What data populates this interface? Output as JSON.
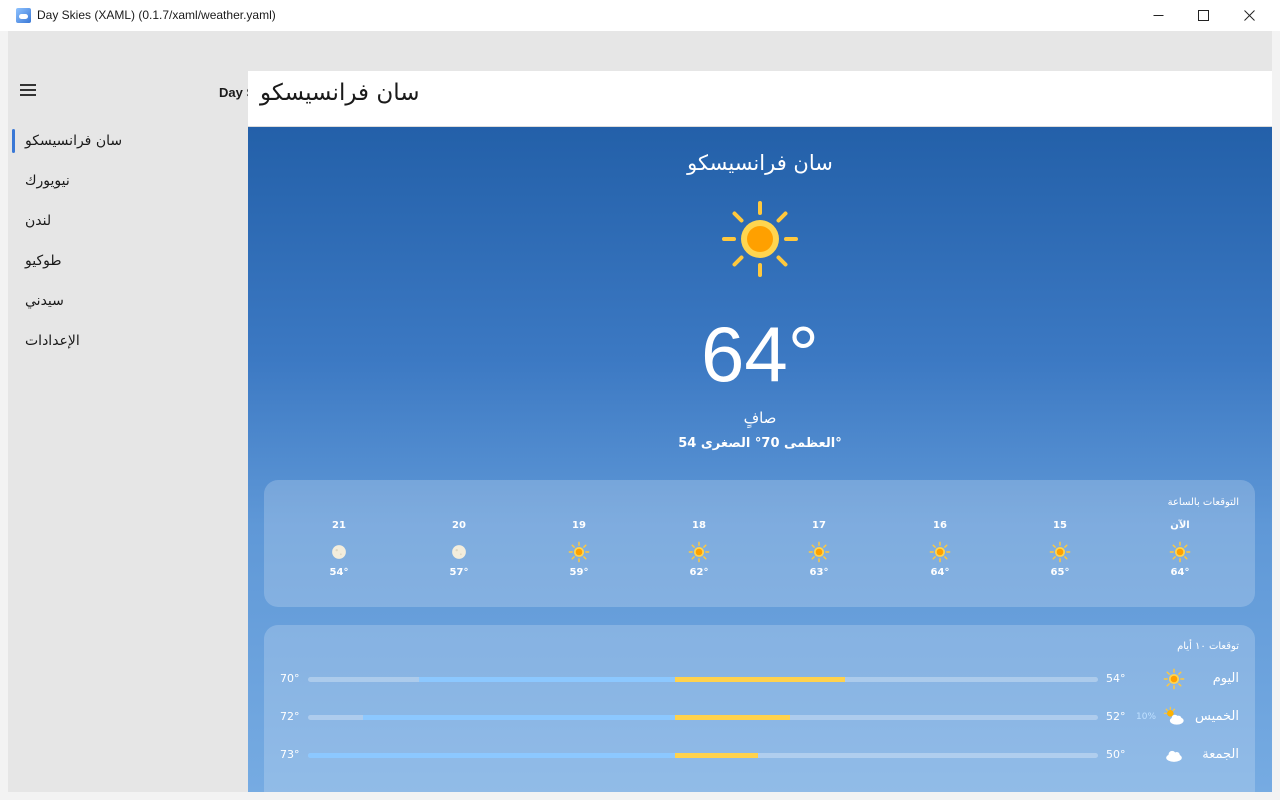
{
  "window": {
    "title": "Day Skies (XAML) (0.1.7/xaml/weather.yaml)"
  },
  "nav": {
    "behind_title": "Day S",
    "items": [
      {
        "label": "سان فرانسيسكو",
        "selected": true
      },
      {
        "label": "نيويورك",
        "selected": false
      },
      {
        "label": "لندن",
        "selected": false
      },
      {
        "label": "طوكيو",
        "selected": false
      },
      {
        "label": "سيدني",
        "selected": false
      },
      {
        "label": "الإعدادات",
        "selected": false
      }
    ]
  },
  "header": {
    "title": "سان فرانسيسكو"
  },
  "current": {
    "city": "سان فرانسيسكو",
    "icon": "sun-icon",
    "temp": "64°",
    "condition": "صافٍ",
    "high_low": "العظمى 70° الصغرى 54°"
  },
  "hourly": {
    "title": "التوقعات بالساعة",
    "items": [
      {
        "label": "الآن",
        "icon": "sun-icon",
        "temp": "64°"
      },
      {
        "label": "15",
        "icon": "sun-icon",
        "temp": "65°"
      },
      {
        "label": "16",
        "icon": "sun-icon",
        "temp": "64°"
      },
      {
        "label": "17",
        "icon": "sun-icon",
        "temp": "63°"
      },
      {
        "label": "18",
        "icon": "sun-icon",
        "temp": "62°"
      },
      {
        "label": "19",
        "icon": "sun-icon",
        "temp": "59°"
      },
      {
        "label": "20",
        "icon": "moon-icon",
        "temp": "57°"
      },
      {
        "label": "21",
        "icon": "moon-icon",
        "temp": "54°"
      }
    ]
  },
  "daily": {
    "title": "توقعات ١٠ أيام",
    "items": [
      {
        "day": "اليوم",
        "icon": "sun-icon",
        "precip": "",
        "low": "54°",
        "high": "70°",
        "low_frac": 0.86,
        "high_frac": 0.32
      },
      {
        "day": "الخميس",
        "icon": "partly-cloudy-icon",
        "precip": "10%",
        "low": "52°",
        "high": "72°",
        "low_frac": 0.93,
        "high_frac": 0.39
      },
      {
        "day": "الجمعة",
        "icon": "cloud-icon",
        "precip": "",
        "low": "50°",
        "high": "73°",
        "low_frac": 1.0,
        "high_frac": 0.43
      }
    ]
  },
  "colors": {
    "accent": "#3a78d6",
    "warm": "#ffd24d",
    "cool": "#8cc8ff",
    "sun": "#ffc107"
  }
}
